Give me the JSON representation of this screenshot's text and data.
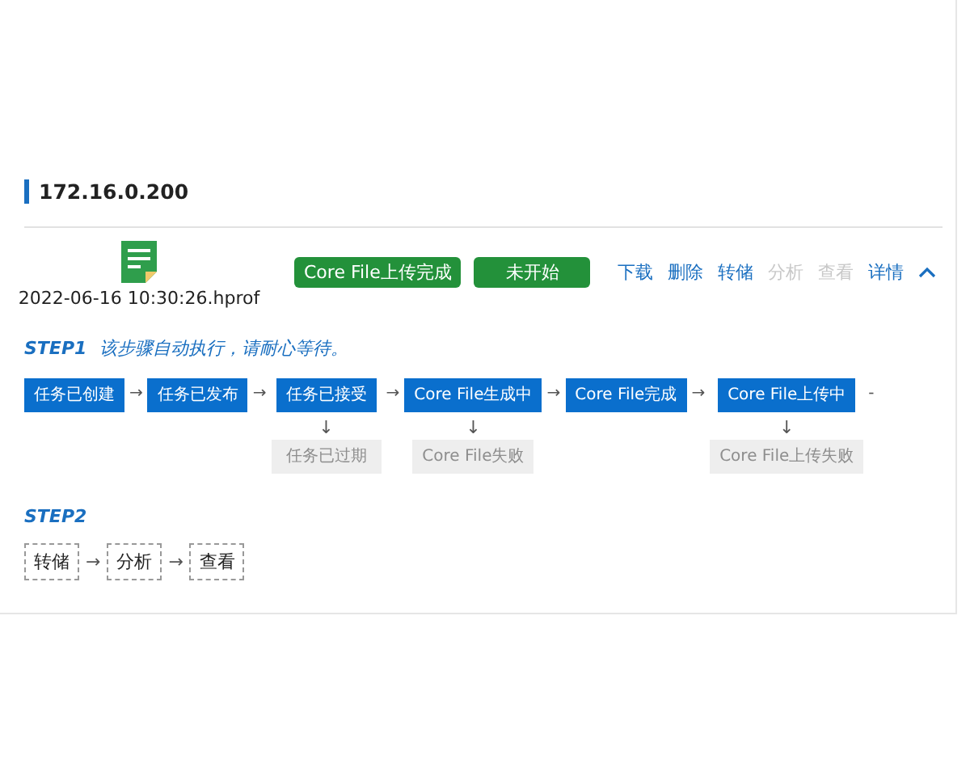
{
  "host": {
    "title": "172.16.0.200"
  },
  "file": {
    "name": "2022-06-16 10:30:26.hprof"
  },
  "badges": [
    {
      "label": "Core File上传完成"
    },
    {
      "label": "未开始"
    }
  ],
  "actions": [
    {
      "label": "下载",
      "disabled": false
    },
    {
      "label": "删除",
      "disabled": false
    },
    {
      "label": "转储",
      "disabled": false
    },
    {
      "label": "分析",
      "disabled": true
    },
    {
      "label": "查看",
      "disabled": true
    },
    {
      "label": "详情",
      "disabled": false
    }
  ],
  "details": {
    "expanded": true
  },
  "step1": {
    "title": "STEP1",
    "hint": "该步骤自动执行，请耐心等待。",
    "steps": [
      {
        "label": "任务已创建",
        "arrow": "→"
      },
      {
        "label": "任务已发布",
        "arrow": "→"
      },
      {
        "label": "任务已接受",
        "arrow": "→",
        "failure": {
          "label": "任务已过期",
          "arrow": "↓"
        }
      },
      {
        "label": "Core File生成中",
        "arrow": "→",
        "failure": {
          "label": "Core File失败",
          "arrow": "↓"
        }
      },
      {
        "label": "Core File完成",
        "arrow": "→"
      },
      {
        "label": "Core File上传中",
        "arrow": "-",
        "failure": {
          "label": "Core File上传失败",
          "arrow": "↓"
        }
      }
    ]
  },
  "step2": {
    "title": "STEP2",
    "steps": [
      {
        "label": "转储",
        "arrow": "→"
      },
      {
        "label": "分析",
        "arrow": "→"
      },
      {
        "label": "查看"
      }
    ]
  }
}
